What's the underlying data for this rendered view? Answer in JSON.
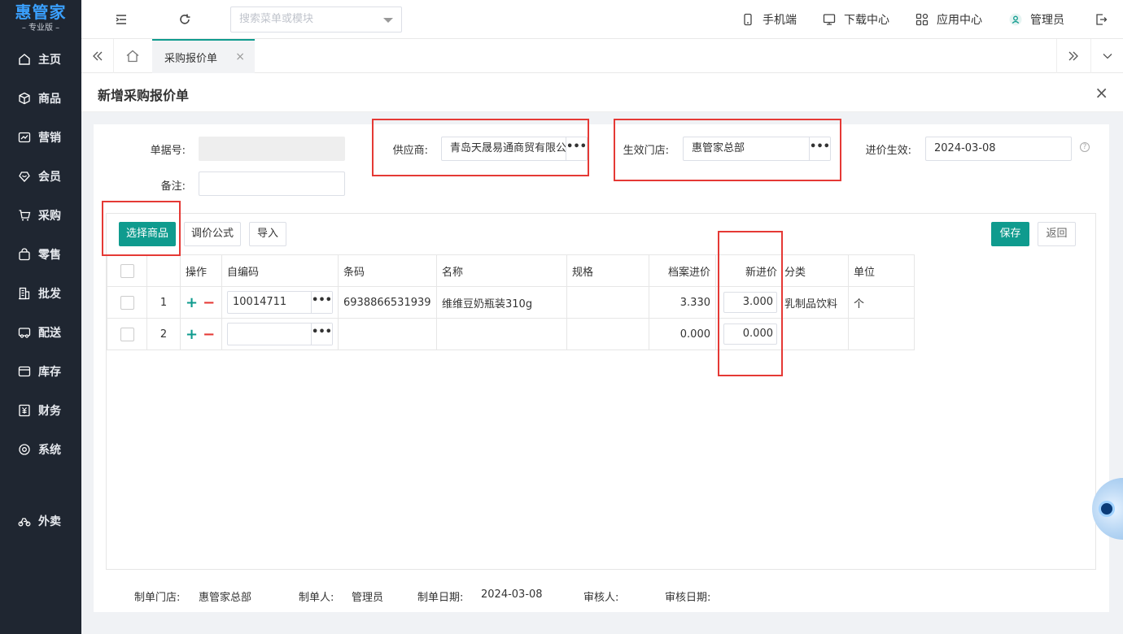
{
  "app": {
    "logo_main": "惠管家",
    "logo_sub": "– 专业版 –"
  },
  "sidebar": {
    "items": [
      {
        "label": "主页",
        "icon": "home-icon"
      },
      {
        "label": "商品",
        "icon": "box-icon"
      },
      {
        "label": "营销",
        "icon": "chart-icon"
      },
      {
        "label": "会员",
        "icon": "member-icon"
      },
      {
        "label": "采购",
        "icon": "cart-icon"
      },
      {
        "label": "零售",
        "icon": "bag-icon"
      },
      {
        "label": "批发",
        "icon": "building-icon"
      },
      {
        "label": "配送",
        "icon": "truck-icon"
      },
      {
        "label": "库存",
        "icon": "inventory-icon"
      },
      {
        "label": "财务",
        "icon": "finance-icon"
      },
      {
        "label": "系统",
        "icon": "settings-icon"
      },
      {
        "label": "外卖",
        "icon": "bike-icon"
      }
    ]
  },
  "topbar": {
    "search_placeholder": "搜索菜单或模块",
    "mobile": "手机端",
    "download": "下载中心",
    "apps": "应用中心",
    "user": "管理员"
  },
  "tabs": {
    "active": "采购报价单",
    "close": "×"
  },
  "page": {
    "title": "新增采购报价单",
    "close": "×"
  },
  "form": {
    "doc_no_label": "单据号:",
    "doc_no_value": "",
    "remark_label": "备注:",
    "remark_value": "",
    "supplier_label": "供应商:",
    "supplier_value": "青岛天晟易通商贸有限公司",
    "store_label": "生效门店:",
    "store_value": "惠管家总部",
    "effective_label": "进价生效:",
    "effective_value": "2024-03-08",
    "dots": "•••",
    "help": "?"
  },
  "toolbar": {
    "select_goods": "选择商品",
    "price_formula": "调价公式",
    "import": "导入",
    "save": "保存",
    "back": "返回"
  },
  "table": {
    "headers": {
      "op": "操作",
      "code": "自编码",
      "barcode": "条码",
      "name": "名称",
      "spec": "规格",
      "archive_price": "档案进价",
      "new_price": "新进价",
      "category": "分类",
      "unit": "单位"
    },
    "rows": [
      {
        "no": "1",
        "code": "10014711",
        "barcode": "6938866531939",
        "name": "维维豆奶瓶装310g",
        "spec": "",
        "archive_price": "3.330",
        "new_price": "3.000",
        "category": "乳制品饮料",
        "unit": "个"
      },
      {
        "no": "2",
        "code": "",
        "barcode": "",
        "name": "",
        "spec": "",
        "archive_price": "0.000",
        "new_price": "0.000",
        "category": "",
        "unit": ""
      }
    ]
  },
  "footer": {
    "store_label": "制单门店:",
    "store_value": "惠管家总部",
    "maker_label": "制单人:",
    "maker_value": "管理员",
    "date_label": "制单日期:",
    "date_value": "2024-03-08",
    "auditor_label": "审核人:",
    "audit_date_label": "审核日期:"
  },
  "colors": {
    "primary": "#0f9b8e",
    "sidebar_bg": "#1f2631",
    "highlight": "#e53935"
  }
}
